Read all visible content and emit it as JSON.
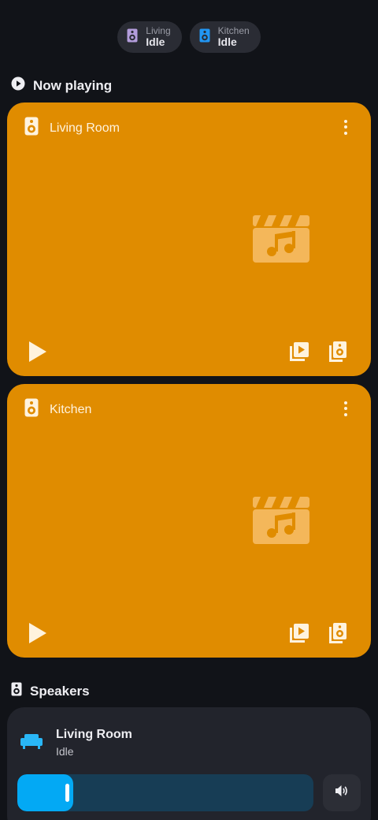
{
  "chips": [
    {
      "name": "Living",
      "state": "Idle",
      "icon": "speaker-icon",
      "color": "#b39ddb"
    },
    {
      "name": "Kitchen",
      "state": "Idle",
      "icon": "speaker-icon",
      "color": "#2196f3"
    }
  ],
  "now_playing": {
    "title": "Now playing",
    "icon": "play-circle-icon",
    "cards": [
      {
        "name": "Living Room",
        "icon": "speaker-icon",
        "art_icon": "music-clapperboard-icon"
      },
      {
        "name": "Kitchen",
        "icon": "speaker-icon",
        "art_icon": "music-clapperboard-icon"
      }
    ]
  },
  "speakers": {
    "title": "Speakers",
    "icon": "speaker-icon",
    "items": [
      {
        "name": "Living Room",
        "state": "Idle",
        "icon": "sofa-icon",
        "volume": 0.19
      }
    ]
  },
  "colors": {
    "card_accent": "#e08c00",
    "slider_fill": "#03a9f4",
    "background": "#111318"
  }
}
